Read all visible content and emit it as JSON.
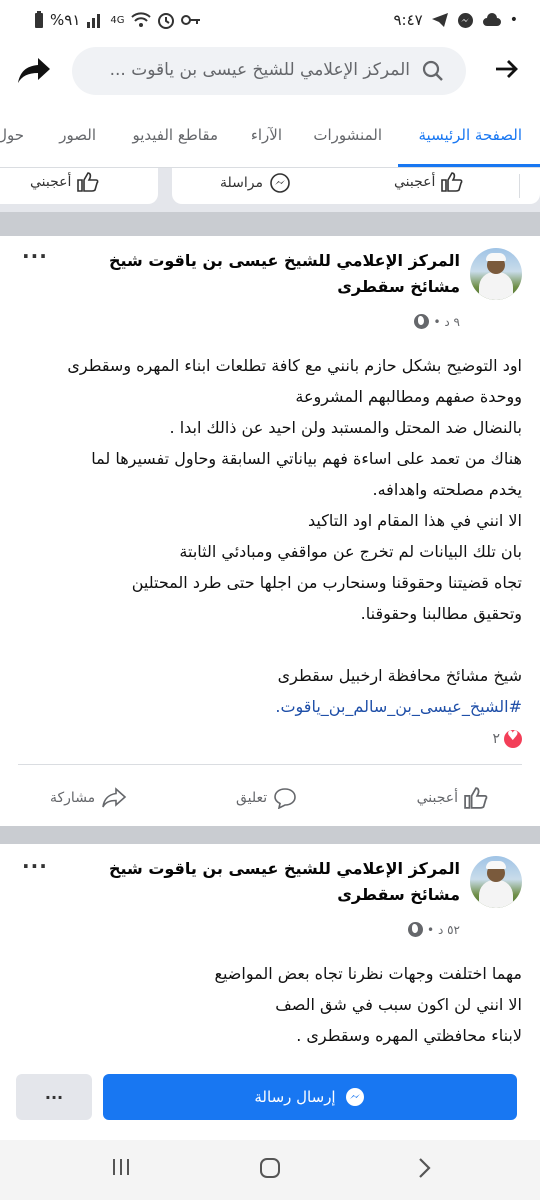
{
  "status_bar": {
    "time": "٩:٤٧",
    "battery": "%٩١",
    "network": "4G"
  },
  "search": {
    "query": "المركز الإعلامي للشيخ عيسى بن ياقوت ..."
  },
  "tabs": [
    {
      "label": "الصفحة الرئيسية",
      "active": true
    },
    {
      "label": "المنشورات"
    },
    {
      "label": "الآراء"
    },
    {
      "label": "مقاطع الفيديو"
    },
    {
      "label": "الصور"
    },
    {
      "label": "حول"
    }
  ],
  "top_strip": {
    "like_left": "أعجبني",
    "message": "مراسلة",
    "like_right": "أعجبني"
  },
  "posts": [
    {
      "author": "المركز الإعلامي للشيخ عيسى بن ياقوت شيخ مشائخ سقطرى",
      "time": "٩ د •",
      "lines": [
        "اود التوضيح بشكل حازم بانني مع كافة تطلعات ابناء المهره وسقطرى",
        "ووحدة صفهم ومطالبهم المشروعة",
        "بالنضال ضد المحتل والمستبد ولن احيد عن ذالك ابدا .",
        "هناك من تعمد على اساءة فهم بياناتي السابقة وحاول تفسيرها لما",
        "يخدم مصلحته واهدافه.",
        "الا انني في هذا المقام اود التاكيد",
        "بان تلك البيانات لم تخرج عن مواقفي ومبادئي الثابتة",
        "تجاه قضيتنا وحقوقنا وسنحارب من اجلها حتى طرد المحتلين",
        "وتحقيق مطالبنا وحقوقنا.",
        "",
        "شيخ مشائخ محافظة ارخبيل سقطرى"
      ],
      "hashtag": "#الشيخ_عيسى_بن_سالم_بن_ياقوت.",
      "reaction_count": "٢",
      "actions": {
        "like": "أعجبني",
        "comment": "تعليق",
        "share": "مشاركة"
      }
    },
    {
      "author": "المركز الإعلامي للشيخ عيسى بن ياقوت شيخ مشائخ سقطرى",
      "time": "٥٢ د •",
      "lines": [
        "مهما اختلفت وجهات نظرنا تجاه بعض المواضيع",
        "الا انني لن اكون سبب في شق الصف",
        "لابناء محافظتي المهره وسقطرى ."
      ]
    }
  ],
  "bottom_bar": {
    "send_message": "إرسال رسالة",
    "more": "..."
  },
  "colors": {
    "accent": "#1877f2",
    "text": "#050505",
    "secondary": "#65676b",
    "heart": "#f33e58"
  }
}
